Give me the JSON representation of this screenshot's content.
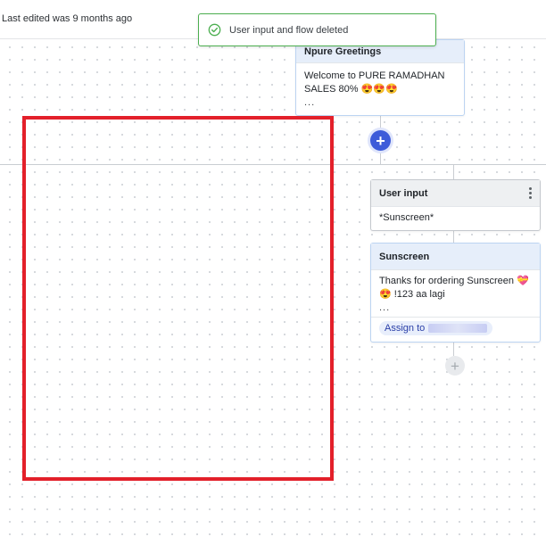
{
  "header": {
    "last_edited": "Last edited was 9 months ago"
  },
  "toast": {
    "message": "User input and flow deleted",
    "icon": "check-circle-icon",
    "color": "#4caf50"
  },
  "nodes": {
    "greetings": {
      "title": "Npure Greetings",
      "line1": "Welcome to   PURE RAMADHAN",
      "line2": "SALES 80% 😍😍😍",
      "more": "..."
    },
    "user_input": {
      "title": "User input",
      "value": "*Sunscreen*"
    },
    "sunscreen": {
      "title": "Sunscreen",
      "line1": "Thanks for ordering Sunscreen 💝",
      "line2": "😍 !123 aa lagi",
      "more": "...",
      "assign_label": "Assign to"
    }
  },
  "colors": {
    "accent": "#3d5bd9",
    "highlight": "#e3202a"
  }
}
